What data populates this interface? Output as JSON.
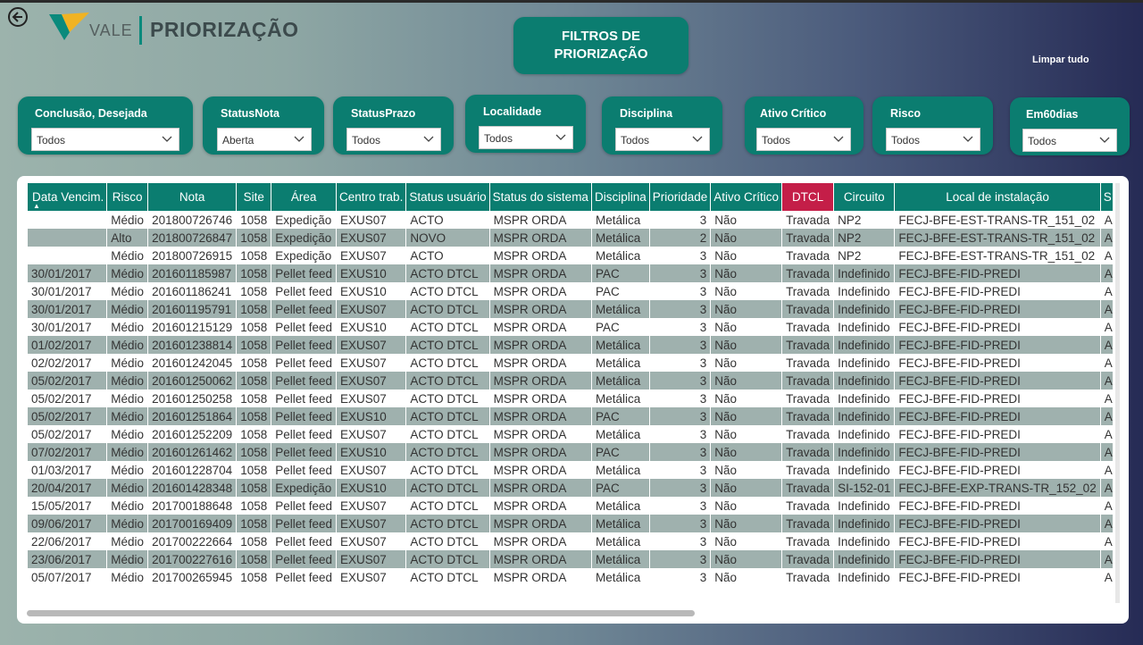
{
  "app": {
    "brand": "VALE",
    "title": "PRIORIZAÇÃO"
  },
  "header": {
    "filter_button": "FILTROS DE\nPRIORIZAÇÃO",
    "clear_all": "Limpar tudo"
  },
  "colors": {
    "teal": "#0b7d70",
    "dtcl_header": "#c41e48",
    "row_alt": "#9fb1ae"
  },
  "slicers": [
    {
      "label": "Conclusão, Desejada",
      "value": "Todos"
    },
    {
      "label": "StatusNota",
      "value": "Aberta"
    },
    {
      "label": "StatusPrazo",
      "value": "Todos"
    },
    {
      "label": "Localidade",
      "value": "Todos"
    },
    {
      "label": "Disciplina",
      "value": "Todos"
    },
    {
      "label": "Ativo Crítico",
      "value": "Todos"
    },
    {
      "label": "Risco",
      "value": "Todos"
    },
    {
      "label": "Em60dias",
      "value": "Todos"
    }
  ],
  "table": {
    "columns": [
      "Data Vencim.",
      "Risco",
      "Nota",
      "Site",
      "Área",
      "Centro trab.",
      "Status usuário",
      "Status do sistema",
      "Disciplina",
      "Prioridade",
      "Ativo Crítico",
      "DTCL",
      "Circuito",
      "Local de instalação",
      "S"
    ],
    "rows": [
      [
        "",
        "Médio",
        "201800726746",
        "1058",
        "Expedição",
        "EXUS07",
        "ACTO",
        "MSPR ORDA",
        "Metálica",
        "3",
        "Não",
        "Travada",
        "NP2",
        "FECJ-BFE-EST-TRANS-TR_151_02",
        "A"
      ],
      [
        "",
        "Alto",
        "201800726847",
        "1058",
        "Expedição",
        "EXUS07",
        "NOVO",
        "MSPR ORDA",
        "Metálica",
        "2",
        "Não",
        "Travada",
        "NP2",
        "FECJ-BFE-EST-TRANS-TR_151_02",
        "A"
      ],
      [
        "",
        "Médio",
        "201800726915",
        "1058",
        "Expedição",
        "EXUS07",
        "ACTO",
        "MSPR ORDA",
        "Metálica",
        "3",
        "Não",
        "Travada",
        "NP2",
        "FECJ-BFE-EST-TRANS-TR_151_02",
        "A"
      ],
      [
        "30/01/2017",
        "Médio",
        "201601185987",
        "1058",
        "Pellet feed",
        "EXUS10",
        "ACTO DTCL",
        "MSPR ORDA",
        "PAC",
        "3",
        "Não",
        "Travada",
        "Indefinido",
        "FECJ-BFE-FID-PREDI",
        "A"
      ],
      [
        "30/01/2017",
        "Médio",
        "201601186241",
        "1058",
        "Pellet feed",
        "EXUS10",
        "ACTO DTCL",
        "MSPR ORDA",
        "PAC",
        "3",
        "Não",
        "Travada",
        "Indefinido",
        "FECJ-BFE-FID-PREDI",
        "A"
      ],
      [
        "30/01/2017",
        "Médio",
        "201601195791",
        "1058",
        "Pellet feed",
        "EXUS07",
        "ACTO DTCL",
        "MSPR ORDA",
        "Metálica",
        "3",
        "Não",
        "Travada",
        "Indefinido",
        "FECJ-BFE-FID-PREDI",
        "A"
      ],
      [
        "30/01/2017",
        "Médio",
        "201601215129",
        "1058",
        "Pellet feed",
        "EXUS10",
        "ACTO DTCL",
        "MSPR ORDA",
        "PAC",
        "3",
        "Não",
        "Travada",
        "Indefinido",
        "FECJ-BFE-FID-PREDI",
        "A"
      ],
      [
        "01/02/2017",
        "Médio",
        "201601238814",
        "1058",
        "Pellet feed",
        "EXUS07",
        "ACTO DTCL",
        "MSPR ORDA",
        "Metálica",
        "3",
        "Não",
        "Travada",
        "Indefinido",
        "FECJ-BFE-FID-PREDI",
        "A"
      ],
      [
        "02/02/2017",
        "Médio",
        "201601242045",
        "1058",
        "Pellet feed",
        "EXUS07",
        "ACTO DTCL",
        "MSPR ORDA",
        "Metálica",
        "3",
        "Não",
        "Travada",
        "Indefinido",
        "FECJ-BFE-FID-PREDI",
        "A"
      ],
      [
        "05/02/2017",
        "Médio",
        "201601250062",
        "1058",
        "Pellet feed",
        "EXUS07",
        "ACTO DTCL",
        "MSPR ORDA",
        "Metálica",
        "3",
        "Não",
        "Travada",
        "Indefinido",
        "FECJ-BFE-FID-PREDI",
        "A"
      ],
      [
        "05/02/2017",
        "Médio",
        "201601250258",
        "1058",
        "Pellet feed",
        "EXUS07",
        "ACTO DTCL",
        "MSPR ORDA",
        "Metálica",
        "3",
        "Não",
        "Travada",
        "Indefinido",
        "FECJ-BFE-FID-PREDI",
        "A"
      ],
      [
        "05/02/2017",
        "Médio",
        "201601251864",
        "1058",
        "Pellet feed",
        "EXUS10",
        "ACTO DTCL",
        "MSPR ORDA",
        "PAC",
        "3",
        "Não",
        "Travada",
        "Indefinido",
        "FECJ-BFE-FID-PREDI",
        "A"
      ],
      [
        "05/02/2017",
        "Médio",
        "201601252209",
        "1058",
        "Pellet feed",
        "EXUS07",
        "ACTO DTCL",
        "MSPR ORDA",
        "Metálica",
        "3",
        "Não",
        "Travada",
        "Indefinido",
        "FECJ-BFE-FID-PREDI",
        "A"
      ],
      [
        "07/02/2017",
        "Médio",
        "201601261462",
        "1058",
        "Pellet feed",
        "EXUS10",
        "ACTO DTCL",
        "MSPR ORDA",
        "PAC",
        "3",
        "Não",
        "Travada",
        "Indefinido",
        "FECJ-BFE-FID-PREDI",
        "A"
      ],
      [
        "01/03/2017",
        "Médio",
        "201601228704",
        "1058",
        "Pellet feed",
        "EXUS07",
        "ACTO DTCL",
        "MSPR ORDA",
        "Metálica",
        "3",
        "Não",
        "Travada",
        "Indefinido",
        "FECJ-BFE-FID-PREDI",
        "A"
      ],
      [
        "20/04/2017",
        "Médio",
        "201601428348",
        "1058",
        "Expedição",
        "EXUS10",
        "ACTO DTCL",
        "MSPR ORDA",
        "PAC",
        "3",
        "Não",
        "Travada",
        "SI-152-01",
        "FECJ-BFE-EXP-TRANS-TR_152_02",
        "A"
      ],
      [
        "15/05/2017",
        "Médio",
        "201700188648",
        "1058",
        "Pellet feed",
        "EXUS07",
        "ACTO DTCL",
        "MSPR ORDA",
        "Metálica",
        "3",
        "Não",
        "Travada",
        "Indefinido",
        "FECJ-BFE-FID-PREDI",
        "A"
      ],
      [
        "09/06/2017",
        "Médio",
        "201700169409",
        "1058",
        "Pellet feed",
        "EXUS07",
        "ACTO DTCL",
        "MSPR ORDA",
        "Metálica",
        "3",
        "Não",
        "Travada",
        "Indefinido",
        "FECJ-BFE-FID-PREDI",
        "A"
      ],
      [
        "22/06/2017",
        "Médio",
        "201700222664",
        "1058",
        "Pellet feed",
        "EXUS07",
        "ACTO DTCL",
        "MSPR ORDA",
        "Metálica",
        "3",
        "Não",
        "Travada",
        "Indefinido",
        "FECJ-BFE-FID-PREDI",
        "A"
      ],
      [
        "23/06/2017",
        "Médio",
        "201700227616",
        "1058",
        "Pellet feed",
        "EXUS07",
        "ACTO DTCL",
        "MSPR ORDA",
        "Metálica",
        "3",
        "Não",
        "Travada",
        "Indefinido",
        "FECJ-BFE-FID-PREDI",
        "A"
      ],
      [
        "05/07/2017",
        "Médio",
        "201700265945",
        "1058",
        "Pellet feed",
        "EXUS07",
        "ACTO DTCL",
        "MSPR ORDA",
        "Metálica",
        "3",
        "Não",
        "Travada",
        "Indefinido",
        "FECJ-BFE-FID-PREDI",
        "A"
      ]
    ]
  }
}
